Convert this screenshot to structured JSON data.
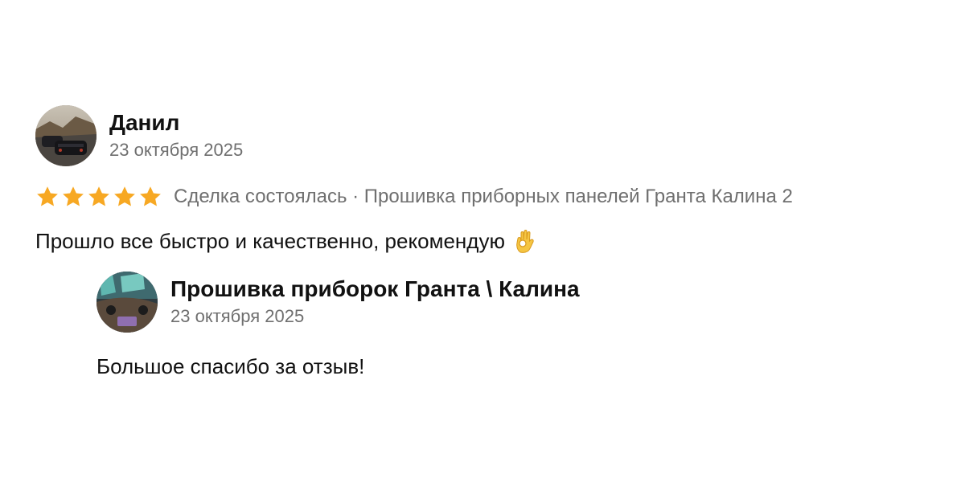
{
  "review": {
    "author_name": "Данил",
    "date": "23 октября 2025",
    "rating": 5,
    "rating_max": 5,
    "star_color": "#f7a823",
    "deal_info": "Сделка состоялась · Прошивка приборных панелей Гранта Калина 2",
    "text": "Прошло все быстро и качественно, рекомендую",
    "emoji_icon": "ok-hand-icon"
  },
  "reply": {
    "author_name": "Прошивка приборок Гранта \\ Калина",
    "date": "23 октября 2025",
    "text": "Большое спасибо за отзыв!"
  }
}
